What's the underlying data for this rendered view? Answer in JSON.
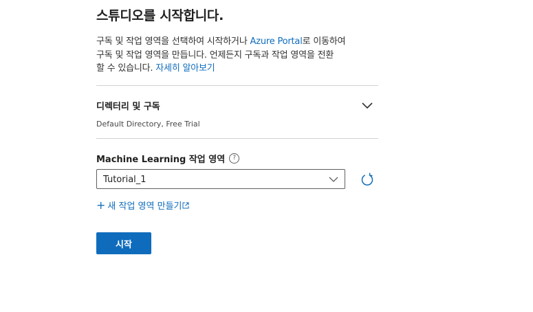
{
  "header": {
    "title": "스튜디오를 시작합니다."
  },
  "description": {
    "line1_prefix": "구독 및 작업 영역을 선택하여 시작하거나 ",
    "line1_link": "Azure Portal",
    "line1_suffix": "로 이동하여",
    "line2": "구독 및 작업 영역을 만듭니다. 언제든지 구독과 작업 영역을 전환",
    "line3_prefix": "할 수 있습니다. ",
    "line3_link": "자세히 알아보기"
  },
  "directory": {
    "label": "디렉터리 및 구독",
    "value": "Default Directory, Free Trial",
    "icon": "chevron-down-icon"
  },
  "workspace": {
    "label": "Machine Learning 작업 영역",
    "help_symbol": "?",
    "selected": "Tutorial_1",
    "refresh_icon": "refresh-icon"
  },
  "create_workspace": {
    "plus": "+",
    "label": "새 작업 영역 만들기"
  },
  "actions": {
    "start_label": "시작"
  },
  "colors": {
    "accent": "#0f6cbd",
    "text": "#201f1e",
    "divider": "#d1d1d1"
  }
}
